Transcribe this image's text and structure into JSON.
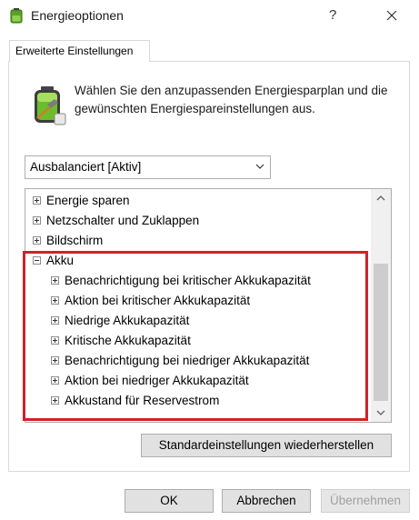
{
  "window": {
    "title": "Energieoptionen",
    "help": "?"
  },
  "tab": {
    "label": "Erweiterte Einstellungen"
  },
  "intro": {
    "text": "Wählen Sie den anzupassenden Energiesparplan und die gewünschten Energiespareinstellungen aus."
  },
  "plan_select": {
    "value": "Ausbalanciert [Aktiv]"
  },
  "tree": {
    "items": [
      {
        "label": "Energie sparen",
        "expanded": false,
        "level": 0
      },
      {
        "label": "Netzschalter und Zuklappen",
        "expanded": false,
        "level": 0
      },
      {
        "label": "Bildschirm",
        "expanded": false,
        "level": 0
      },
      {
        "label": "Akku",
        "expanded": true,
        "level": 0
      },
      {
        "label": "Benachrichtigung bei kritischer Akkukapazität",
        "expanded": false,
        "level": 1
      },
      {
        "label": "Aktion bei kritischer Akkukapazität",
        "expanded": false,
        "level": 1
      },
      {
        "label": "Niedrige Akkukapazität",
        "expanded": false,
        "level": 1
      },
      {
        "label": "Kritische Akkukapazität",
        "expanded": false,
        "level": 1
      },
      {
        "label": "Benachrichtigung bei niedriger Akkukapazität",
        "expanded": false,
        "level": 1
      },
      {
        "label": "Aktion bei niedriger Akkukapazität",
        "expanded": false,
        "level": 1
      },
      {
        "label": "Akkustand für Reservestrom",
        "expanded": false,
        "level": 1
      }
    ]
  },
  "buttons": {
    "restore": "Standardeinstellungen wiederherstellen",
    "ok": "OK",
    "cancel": "Abbrechen",
    "apply": "Übernehmen"
  },
  "colors": {
    "highlight": "#d0212b",
    "button_bg": "#e1e1e1",
    "disabled_text": "#a0a0a0"
  },
  "icons": {
    "app": "battery-power-icon",
    "intro": "battery-plan-icon",
    "dropdown": "chevron-down-icon",
    "close": "close-icon"
  }
}
